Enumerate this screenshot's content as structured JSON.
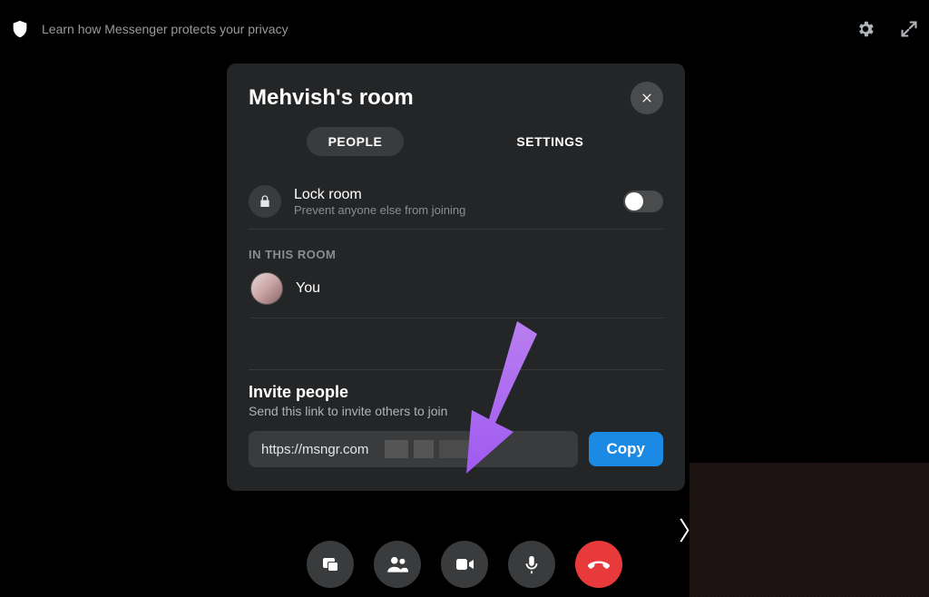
{
  "topbar": {
    "privacy_link": "Learn how Messenger protects your privacy"
  },
  "modal": {
    "title": "Mehvish's room",
    "tabs": {
      "people": "PEOPLE",
      "settings": "SETTINGS"
    },
    "lock": {
      "title": "Lock room",
      "subtitle": "Prevent anyone else from joining"
    },
    "section_in_room": "IN THIS ROOM",
    "participants": [
      {
        "name": "You"
      }
    ],
    "invite": {
      "title": "Invite people",
      "subtitle": "Send this link to invite others to join",
      "link_visible": "https://msngr.com",
      "copy_label": "Copy"
    }
  }
}
